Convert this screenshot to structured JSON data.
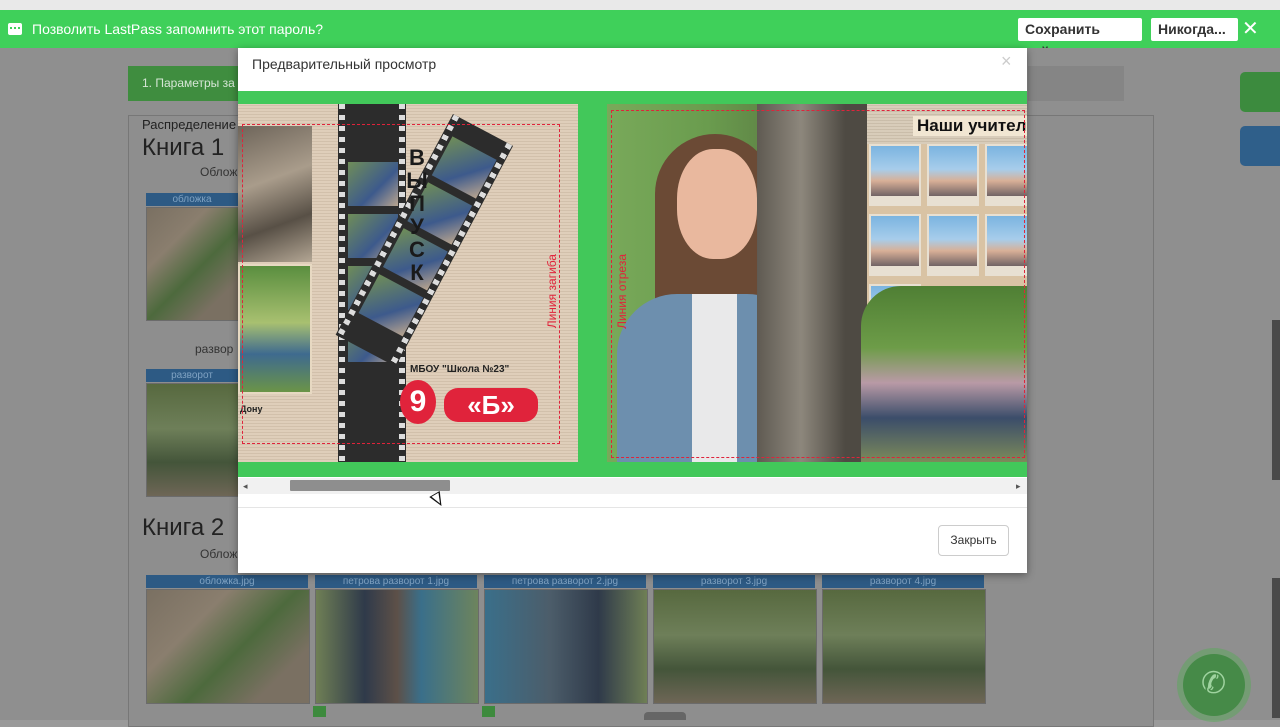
{
  "lastpass": {
    "prompt": "Позволить LastPass запомнить этот пароль?",
    "save_site": "Сохранить сайт",
    "never": "Никогда...",
    "close": "✕"
  },
  "background": {
    "step_tab": "1. Параметры за",
    "distribution": "Распределение",
    "book1": "Книга 1",
    "book2": "Книга 2",
    "cover": "Облож",
    "spread": "развор",
    "thumbs_row1": [
      "обложка",
      "разворот"
    ],
    "thumbs_row2": [
      "обложка.jpg",
      "петрова разворот 1.jpg",
      "петрова разворот 2.jpg",
      "разворот 3.jpg",
      "разворот 4.jpg"
    ]
  },
  "modal": {
    "title": "Предварительный просмотр",
    "close_x": "×",
    "close_button": "Закрыть",
    "scroll_left": "◂",
    "scroll_right": "▸"
  },
  "left_page": {
    "vypusk": [
      "В",
      "Ы",
      "П",
      "У",
      "С",
      "К"
    ],
    "school": "МБОУ \"Школа №23\"",
    "grade_number": "9",
    "grade_letter": "«Б»",
    "fold_line": "Линия загиба",
    "donu": "Дону"
  },
  "right_page": {
    "cut_line": "Линия отреза",
    "teachers_title": "Наши учител"
  },
  "colors": {
    "lastpass_green": "#3fd05a",
    "preview_green": "#42c85a",
    "guide_red": "#e0233b"
  }
}
